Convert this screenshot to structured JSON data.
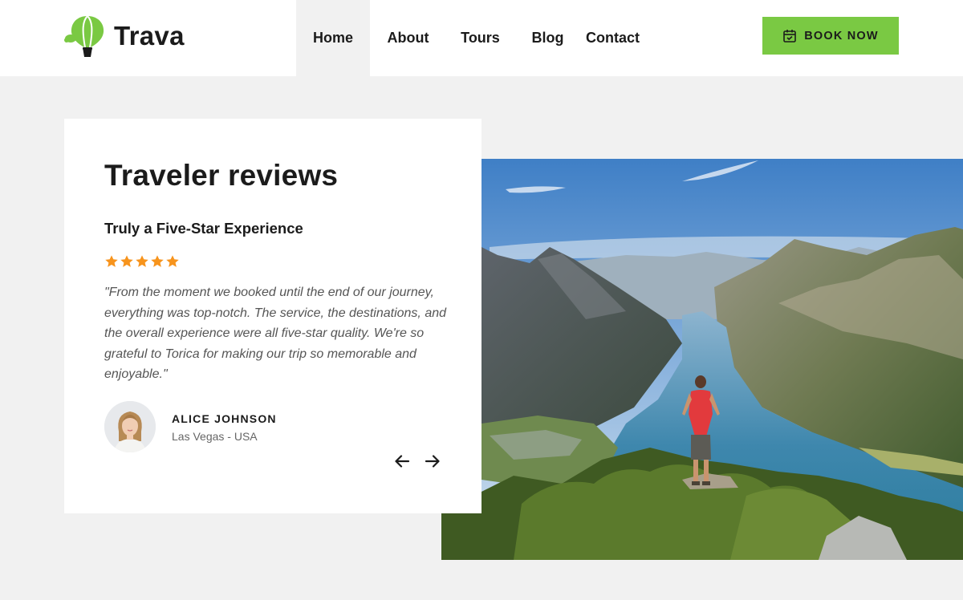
{
  "brand": {
    "name": "Trava",
    "logo_icon": "hot-air-balloon-icon",
    "accent_color": "#7ac943"
  },
  "nav": {
    "items": [
      {
        "label": "Home",
        "active": true
      },
      {
        "label": "About",
        "active": false
      },
      {
        "label": "Tours",
        "active": false
      },
      {
        "label": "Blog",
        "active": false
      },
      {
        "label": "Contact",
        "active": false
      }
    ]
  },
  "header": {
    "book_button": {
      "label": "BOOK NOW",
      "icon": "calendar-check-icon"
    }
  },
  "reviews": {
    "section_title": "Traveler reviews",
    "review_title": "Truly a Five-Star Experience",
    "rating": 5,
    "rating_max": 5,
    "star_color": "#f7941d",
    "quote": "\"From the moment we booked until the end of our journey, everything was top-notch. The service, the destinations, and the overall experience were all five-star quality. We're so grateful to Torica for making our trip so memorable and enjoyable.\"",
    "author": {
      "name": "ALICE JOHNSON",
      "location": "Las Vegas - USA",
      "avatar_icon": "avatar"
    },
    "prev_icon": "arrow-left-icon",
    "next_icon": "arrow-right-icon"
  }
}
